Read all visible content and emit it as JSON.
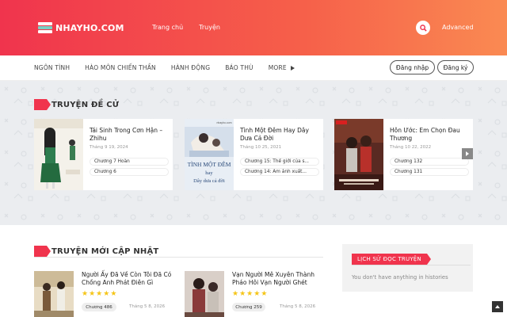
{
  "brand": {
    "name": "NHAYHO.COM",
    "accent": "#f0344d"
  },
  "topnav": {
    "items": [
      "Trang chủ",
      "Truyện"
    ],
    "advanced": "Advanced",
    "search_icon": "search-icon"
  },
  "navbar": {
    "items": [
      "NGÔN TÌNH",
      "HÀO MÔN CHIẾN THẦN",
      "HÀNH ĐỘNG",
      "BÁO THÙ"
    ],
    "more": "MORE",
    "login": "Đăng nhập",
    "register": "Đăng ký"
  },
  "featured": {
    "title": "TRUYỆN ĐỀ CỬ",
    "cover_text": "nhayho.com",
    "cards": [
      {
        "title": "Tái Sinh Trong Cơn Hận – Zhihu",
        "date": "Tháng 9 19, 2024",
        "chapters": [
          "Chương 7 Hoàn",
          "Chương 6"
        ]
      },
      {
        "title": "Tình Một Đêm Hay Dây Dưa Cả Đời",
        "date": "Tháng 10 25, 2021",
        "chapters": [
          "Chương 15: Thế giới của s...",
          "Chương 14: Âm ảnh xuất..."
        ],
        "cover_lines": [
          "TÌNH MỘT ĐÊM",
          "hay",
          "Dây dưa cả đời"
        ]
      },
      {
        "title": "Hôn Ước: Em Chọn Đau Thương",
        "date": "Tháng 10 22, 2022",
        "chapters": [
          "Chương 132",
          "Chương 131"
        ]
      }
    ]
  },
  "updates": {
    "title": "TRUYỆN MỚI CẬP NHẬT",
    "items": [
      {
        "title": "Người Ấy Đã Về Còn Tôi Đã Có Chồng Anh Phát Điên Gì",
        "rating": 5,
        "chapter": "Chương 486",
        "date": "Tháng 5 8, 2026"
      },
      {
        "title": "Vạn Người Mê Xuyên Thành Pháo Hôi Vạn Người Ghét",
        "rating": 5,
        "chapter": "Chương 259",
        "date": "Tháng 5 8, 2026"
      }
    ]
  },
  "history": {
    "title": "LỊCH SỬ ĐỌC TRUYỆN",
    "empty": "You don't have anything in histories"
  }
}
